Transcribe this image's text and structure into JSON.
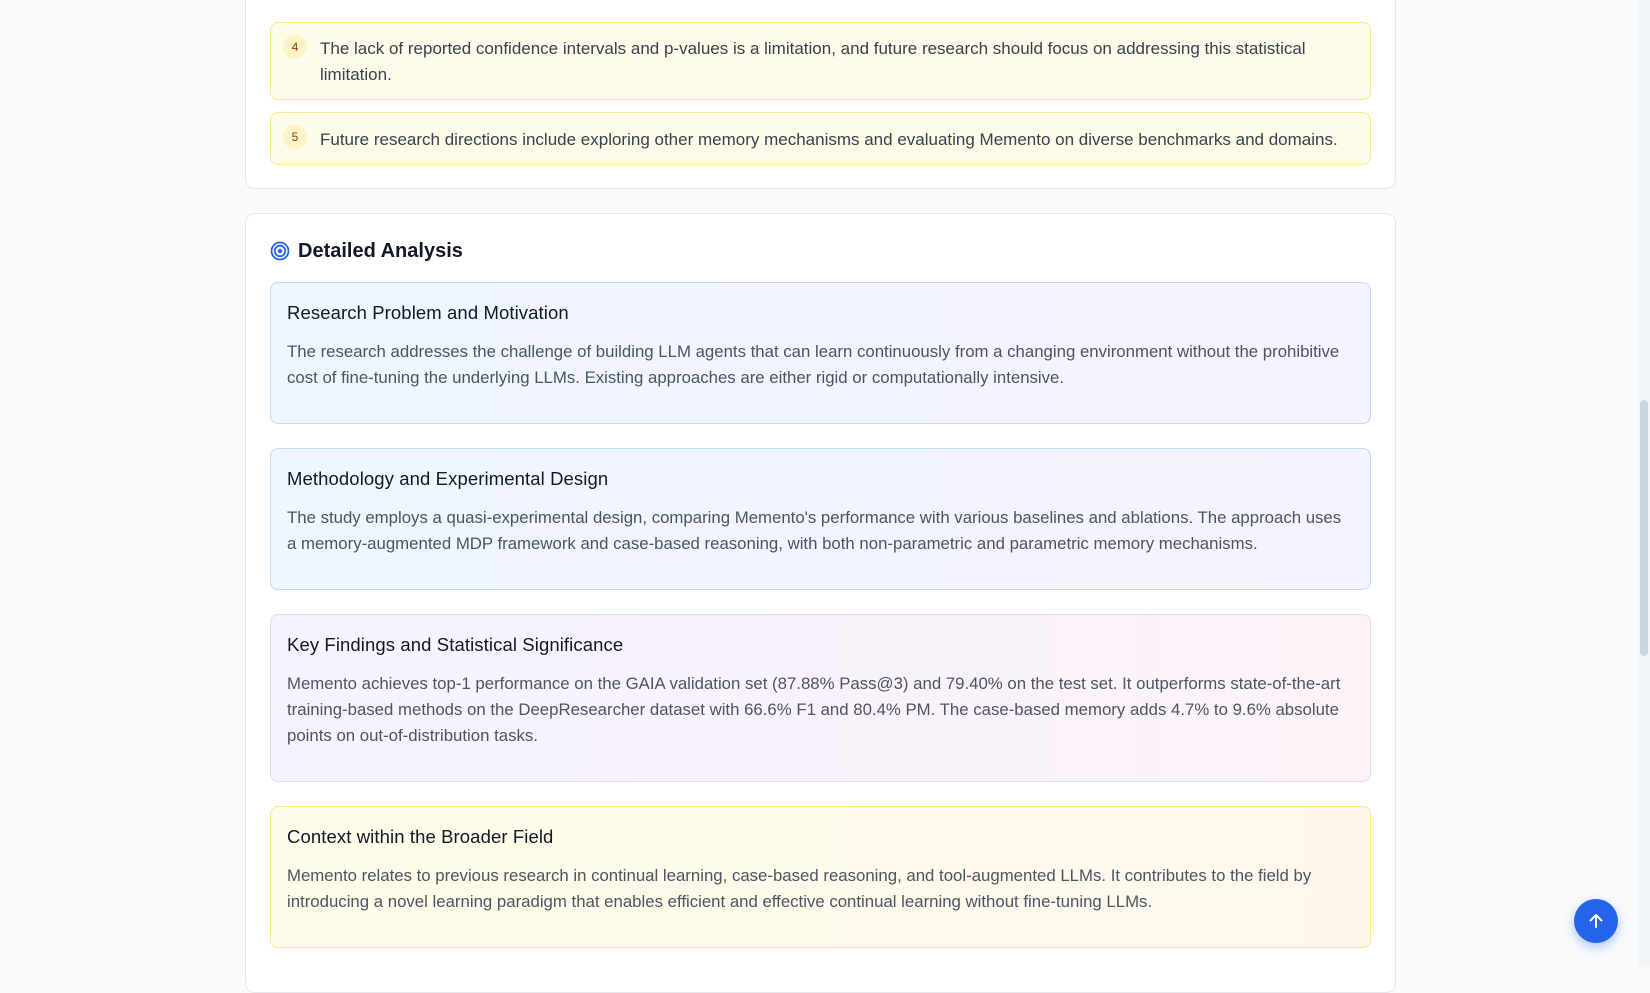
{
  "limitations": {
    "items": [
      {
        "number": "4",
        "text": "The lack of reported confidence intervals and p-values is a limitation, and future research should focus on addressing this statistical limitation."
      },
      {
        "number": "5",
        "text": "Future research directions include exploring other memory mechanisms and evaluating Memento on diverse benchmarks and domains."
      }
    ]
  },
  "analysis": {
    "title": "Detailed Analysis",
    "icon": "target-icon",
    "sections": [
      {
        "heading": "Research Problem and Motivation",
        "body": "The research addresses the challenge of building LLM agents that can learn continuously from a changing environment without the prohibitive cost of fine-tuning the underlying LLMs. Existing approaches are either rigid or computationally intensive."
      },
      {
        "heading": "Methodology and Experimental Design",
        "body": "The study employs a quasi-experimental design, comparing Memento's performance with various baselines and ablations. The approach uses a memory-augmented MDP framework and case-based reasoning, with both non-parametric and parametric memory mechanisms."
      },
      {
        "heading": "Key Findings and Statistical Significance",
        "body": "Memento achieves top-1 performance on the GAIA validation set (87.88% Pass@3) and 79.40% on the test set. It outperforms state-of-the-art training-based methods on the DeepResearcher dataset with 66.6% F1 and 80.4% PM. The case-based memory adds 4.7% to 9.6% absolute points on out-of-distribution tasks."
      },
      {
        "heading": "Context within the Broader Field",
        "body": "Memento relates to previous research in continual learning, case-based reasoning, and tool-augmented LLMs. It contributes to the field by introducing a novel learning paradigm that enables efficient and effective continual learning without fine-tuning LLMs."
      }
    ]
  },
  "controls": {
    "scroll_top_icon": "arrow-up-icon"
  },
  "colors": {
    "accent": "#2563eb",
    "item_background": "#fefce8",
    "item_border": "#fde68a"
  }
}
